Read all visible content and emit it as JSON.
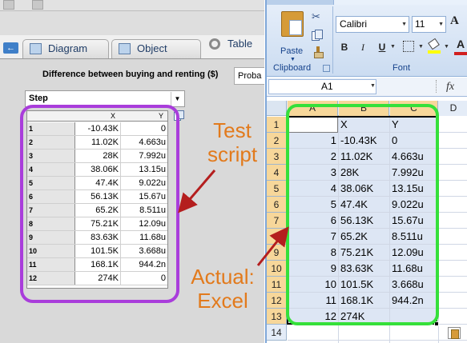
{
  "left_app": {
    "tabs": [
      {
        "label": "Diagram",
        "icon": "diagram-icon"
      },
      {
        "label": "Object",
        "icon": "object-icon"
      },
      {
        "label": "Table",
        "icon": "table-icon"
      }
    ],
    "chart_title": "Difference between buying and renting ($)",
    "probability_select": "Proba",
    "step_dropdown": "Step",
    "grid": {
      "columns": [
        "X",
        "Y"
      ],
      "rows": [
        {
          "row": "1",
          "x": "-10.43K",
          "y": "0"
        },
        {
          "row": "2",
          "x": "11.02K",
          "y": "4.663u"
        },
        {
          "row": "3",
          "x": "28K",
          "y": "7.992u"
        },
        {
          "row": "4",
          "x": "38.06K",
          "y": "13.15u"
        },
        {
          "row": "5",
          "x": "47.4K",
          "y": "9.022u"
        },
        {
          "row": "6",
          "x": "56.13K",
          "y": "15.67u"
        },
        {
          "row": "7",
          "x": "65.2K",
          "y": "8.511u"
        },
        {
          "row": "8",
          "x": "75.21K",
          "y": "12.09u"
        },
        {
          "row": "9",
          "x": "83.63K",
          "y": "11.68u"
        },
        {
          "row": "10",
          "x": "101.5K",
          "y": "3.668u"
        },
        {
          "row": "11",
          "x": "168.1K",
          "y": "944.2n"
        },
        {
          "row": "12",
          "x": "274K",
          "y": "0"
        }
      ]
    }
  },
  "excel": {
    "ribbon": {
      "paste_label": "Paste",
      "clipboard_label": "Clipboard",
      "font_name": "Calibri",
      "font_size": "11",
      "bold": "B",
      "italic": "I",
      "underline": "U",
      "grow_font": "A",
      "font_color": "A",
      "font_group_label": "Font"
    },
    "name_box": "A1",
    "fx": "fx",
    "columns": [
      "A",
      "B",
      "C"
    ],
    "extra_column": "D",
    "row_headers": [
      "1",
      "2",
      "3",
      "4",
      "5",
      "6",
      "7",
      "8",
      "9",
      "10",
      "11",
      "12",
      "13",
      "14"
    ],
    "rows": [
      {
        "a": "",
        "b": "X",
        "c": "Y"
      },
      {
        "a": "1",
        "b": "-10.43K",
        "c": "0"
      },
      {
        "a": "2",
        "b": "11.02K",
        "c": "4.663u"
      },
      {
        "a": "3",
        "b": "28K",
        "c": "7.992u"
      },
      {
        "a": "4",
        "b": "38.06K",
        "c": "13.15u"
      },
      {
        "a": "5",
        "b": "47.4K",
        "c": "9.022u"
      },
      {
        "a": "6",
        "b": "56.13K",
        "c": "15.67u"
      },
      {
        "a": "7",
        "b": "65.2K",
        "c": "8.511u"
      },
      {
        "a": "8",
        "b": "75.21K",
        "c": "12.09u"
      },
      {
        "a": "9",
        "b": "83.63K",
        "c": "11.68u"
      },
      {
        "a": "10",
        "b": "101.5K",
        "c": "3.668u"
      },
      {
        "a": "11",
        "b": "168.1K",
        "c": "944.2n"
      },
      {
        "a": "12",
        "b": "274K",
        "c": ""
      },
      {
        "a": "",
        "b": "",
        "c": ""
      }
    ]
  },
  "annotations": {
    "test_script_line1": "Test",
    "test_script_line2": "script",
    "actual_line1": "Actual:",
    "actual_line2": "Excel",
    "colors": {
      "test_box": "#a93ddb",
      "excel_box": "#35e03a",
      "text": "#e27a1c",
      "arrow": "#b41e1e"
    }
  }
}
